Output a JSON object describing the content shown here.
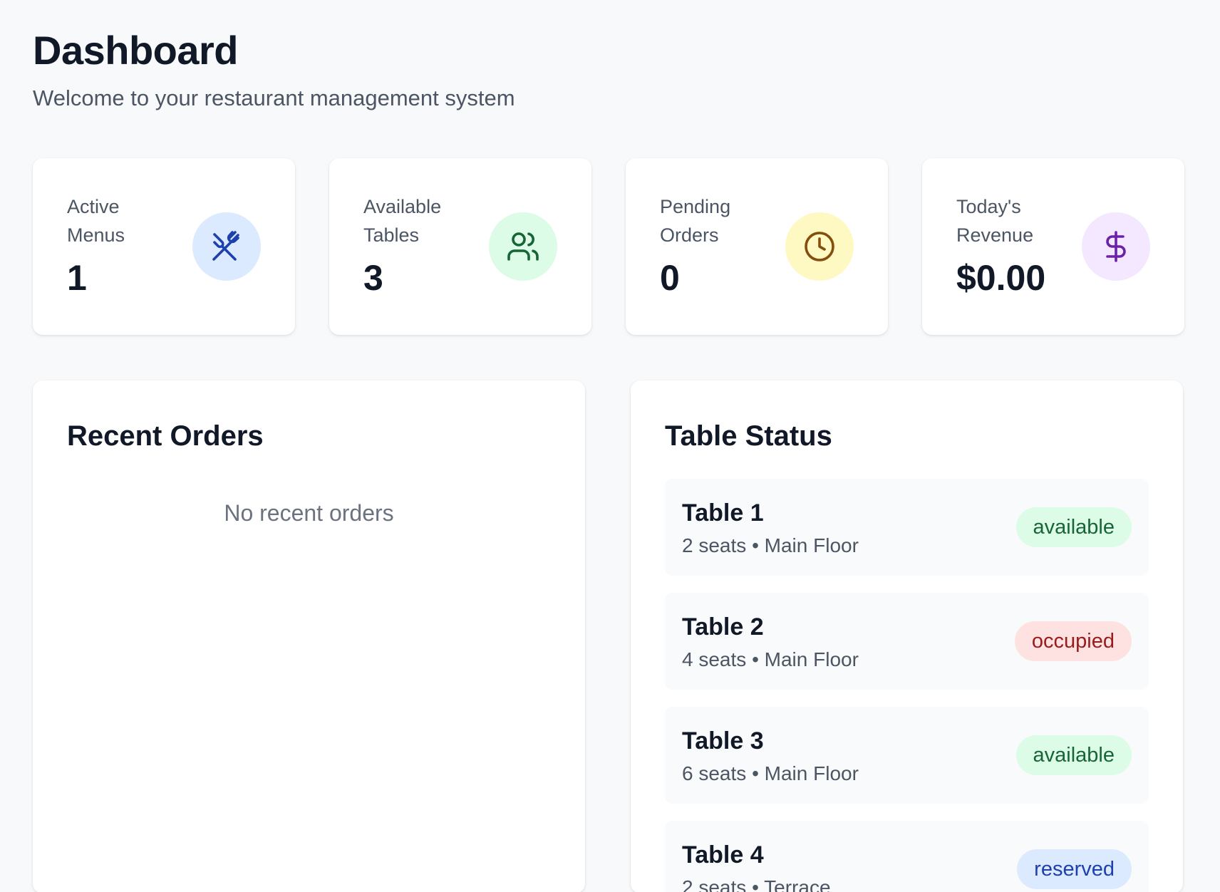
{
  "header": {
    "title": "Dashboard",
    "subtitle": "Welcome to your restaurant management system"
  },
  "stats": [
    {
      "label": "Active Menus",
      "value": "1",
      "icon": "utensils-icon",
      "icon_bg": "#dbeafe",
      "icon_color": "#1e40af"
    },
    {
      "label": "Available Tables",
      "value": "3",
      "icon": "users-icon",
      "icon_bg": "#dcfce7",
      "icon_color": "#166534"
    },
    {
      "label": "Pending Orders",
      "value": "0",
      "icon": "clock-icon",
      "icon_bg": "#fef9c3",
      "icon_color": "#854d0e"
    },
    {
      "label": "Today's Revenue",
      "value": "$0.00",
      "icon": "dollar-icon",
      "icon_bg": "#f3e8ff",
      "icon_color": "#6b21a8"
    }
  ],
  "recent_orders": {
    "title": "Recent Orders",
    "empty_text": "No recent orders"
  },
  "table_status": {
    "title": "Table Status",
    "separator": "•",
    "tables": [
      {
        "name": "Table 1",
        "seats": "2 seats",
        "location": "Main Floor",
        "status": "available"
      },
      {
        "name": "Table 2",
        "seats": "4 seats",
        "location": "Main Floor",
        "status": "occupied"
      },
      {
        "name": "Table 3",
        "seats": "6 seats",
        "location": "Main Floor",
        "status": "available"
      },
      {
        "name": "Table 4",
        "seats": "2 seats",
        "location": "Terrace",
        "status": "reserved"
      }
    ]
  },
  "status_colors": {
    "available": {
      "bg": "#dcfce7",
      "fg": "#166534"
    },
    "occupied": {
      "bg": "#fee2e2",
      "fg": "#991b1b"
    },
    "reserved": {
      "bg": "#dbeafe",
      "fg": "#1e40af"
    }
  }
}
